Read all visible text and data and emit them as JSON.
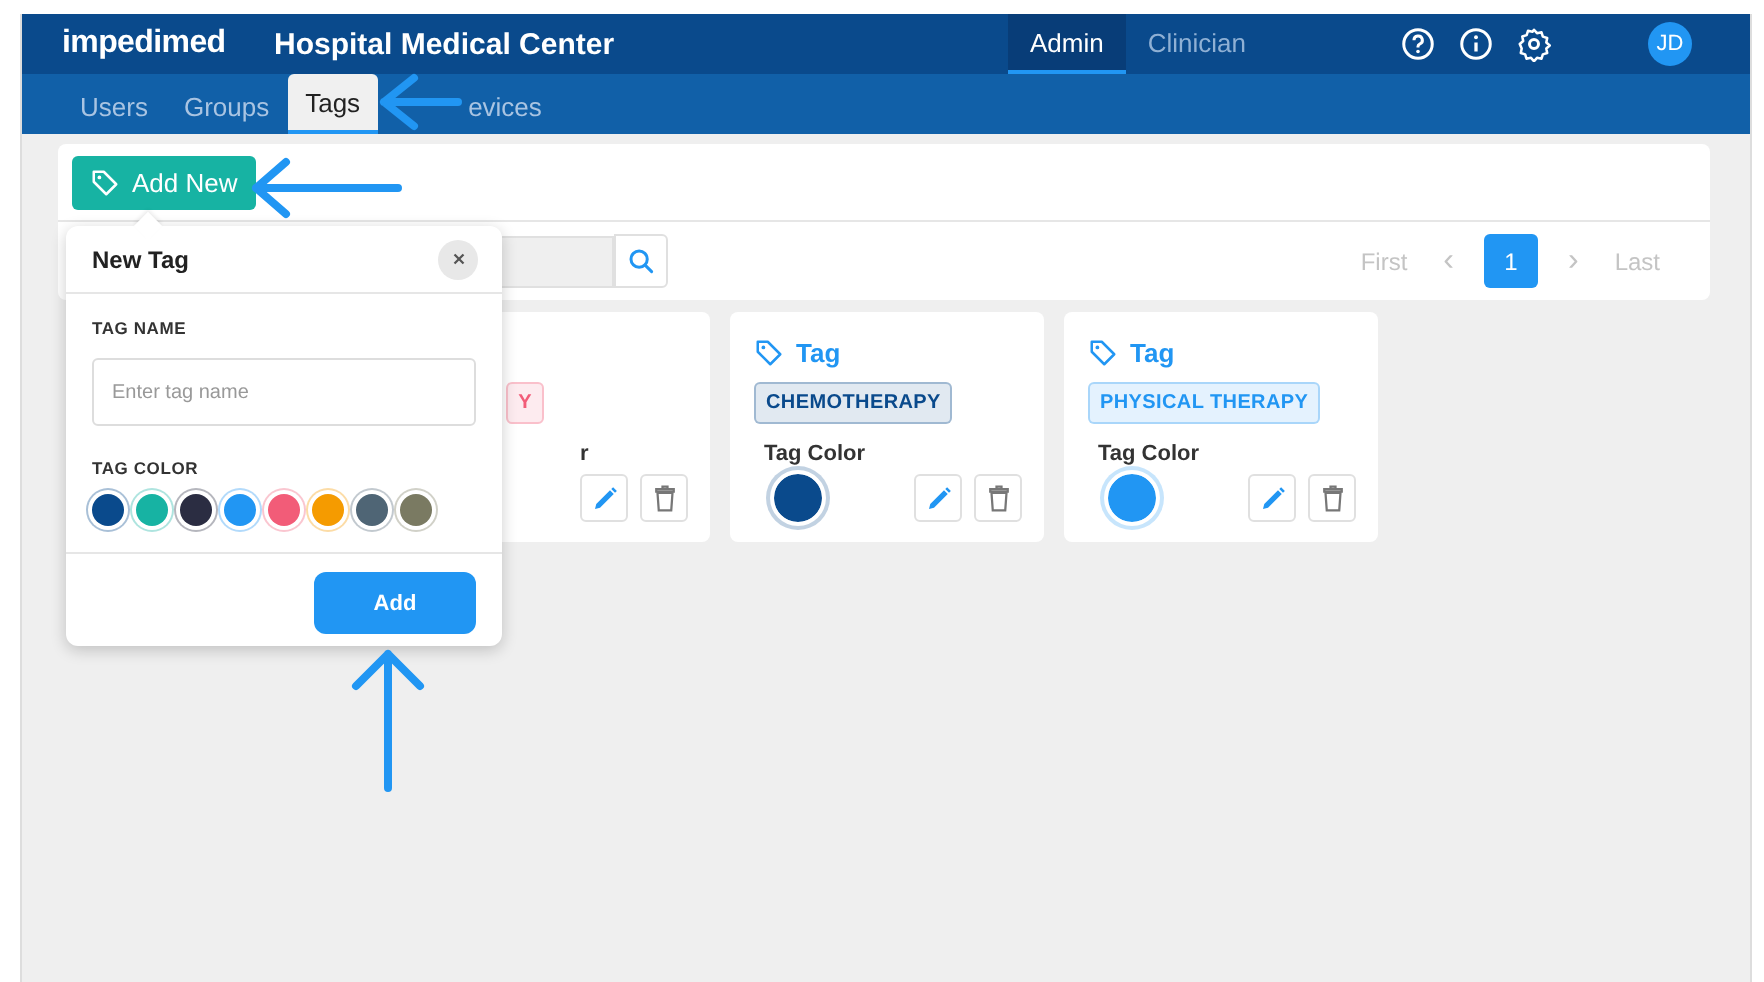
{
  "header": {
    "logo": "impedimed",
    "title": "Hospital Medical Center",
    "modes": [
      {
        "label": "Admin",
        "selected": true
      },
      {
        "label": "Clinician",
        "selected": false
      }
    ],
    "avatar": "JD"
  },
  "subnav": [
    {
      "label": "Users",
      "selected": false
    },
    {
      "label": "Groups",
      "selected": false
    },
    {
      "label": "Tags",
      "selected": true
    },
    {
      "label": "evices",
      "selected": false
    }
  ],
  "toolbar": {
    "add_button": "Add New"
  },
  "pagination": [
    {
      "kind": "text",
      "label": "First",
      "disabled": true,
      "selected": false
    },
    {
      "kind": "prev",
      "label": "‹",
      "disabled": true,
      "selected": false
    },
    {
      "kind": "page",
      "label": "1",
      "selected": true
    },
    {
      "kind": "next",
      "label": "›",
      "disabled": true,
      "selected": false
    },
    {
      "kind": "text",
      "label": "Last",
      "disabled": true,
      "selected": false
    }
  ],
  "cards": [
    {
      "badge": "Y",
      "color_label": "r",
      "color": "#f25c78"
    },
    {
      "title": "Tag",
      "badge": "CHEMOTHERAPY",
      "color_label": "Tag Color",
      "color": "#0a4a8c"
    },
    {
      "title": "Tag",
      "badge": "PHYSICAL THERAPY",
      "color_label": "Tag Color",
      "color": "#2196f3"
    }
  ],
  "popover": {
    "title": "New Tag",
    "name_label": "TAG NAME",
    "placeholder": "Enter tag name",
    "color_label": "TAG COLOR",
    "colors": [
      {
        "color": "#0a4a8c"
      },
      {
        "color": "#17b3a3"
      },
      {
        "color": "#2b2d42"
      },
      {
        "color": "#2196f3"
      },
      {
        "color": "#f25c78"
      },
      {
        "color": "#f59b00"
      },
      {
        "color": "#4f6575"
      },
      {
        "color": "#7a7a62"
      }
    ],
    "submit": "Add"
  }
}
